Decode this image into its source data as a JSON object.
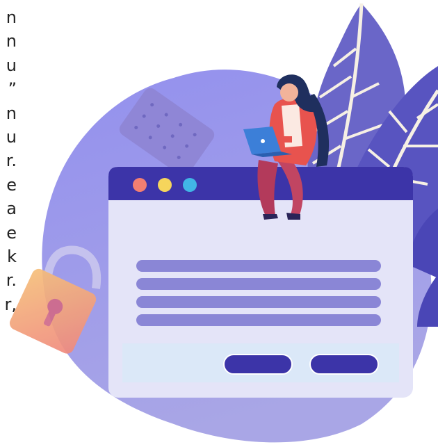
{
  "text_fragments": [
    "n",
    "n",
    "u",
    "”",
    "n",
    "u",
    "r.",
    "e",
    "a",
    "e",
    "k",
    "r.",
    "r,"
  ],
  "illustration": {
    "browser_dots": [
      "#f47f71",
      "#f6d55c",
      "#41b6e6"
    ],
    "accent": "#3c34a8",
    "blob": "#8c89e2",
    "window_body": "#e4e4f8",
    "text_lines": "#8a86d6",
    "footer": "#dbe8f8",
    "lock_body": "#f5a97a",
    "leaves": "#6a66c8"
  },
  "icons": [
    "padlock-icon",
    "cracker-icon",
    "laptop-icon"
  ]
}
